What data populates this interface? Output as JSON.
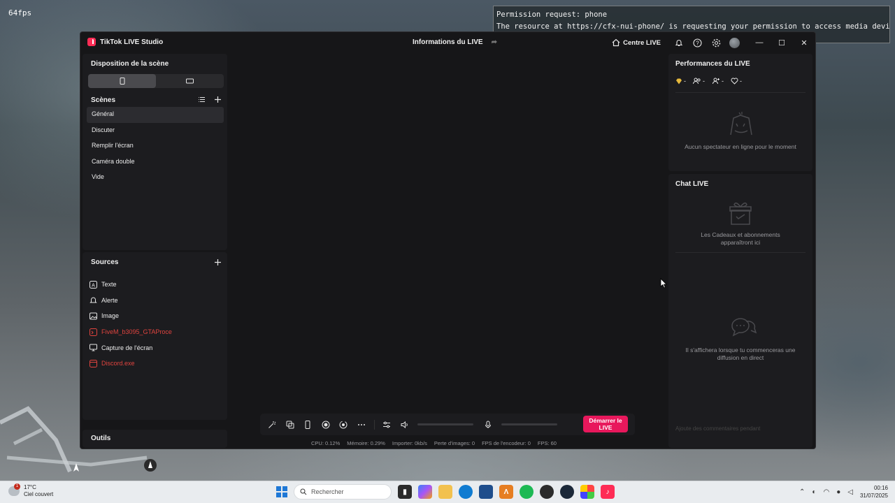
{
  "overlay": {
    "fps": "64fps",
    "permission_title": "Permission request: phone",
    "permission_body": "The resource at https://cfx-nui-phone/ is requesting your permission to access media devices."
  },
  "window": {
    "app_name": "TikTok LIVE Studio",
    "center_title": "Informations du LIVE",
    "centre_live_label": "Centre LIVE"
  },
  "scene_panel": {
    "title": "Disposition de la scène",
    "scenes_header": "Scènes",
    "scenes": [
      "Général",
      "Discuter",
      "Remplir l'écran",
      "Caméra double",
      "Vide"
    ],
    "selected_scene": "Général"
  },
  "sources_panel": {
    "title": "Sources",
    "items": [
      {
        "label": "Texte",
        "icon": "text-icon",
        "error": false
      },
      {
        "label": "Alerte",
        "icon": "bell-icon",
        "error": false
      },
      {
        "label": "Image",
        "icon": "image-icon",
        "error": false
      },
      {
        "label": "FiveM_b3095_GTAProce",
        "icon": "game-capture-icon",
        "error": true
      },
      {
        "label": "Capture de l'écran",
        "icon": "monitor-icon",
        "error": false
      },
      {
        "label": "Discord.exe",
        "icon": "window-capture-icon",
        "error": true
      }
    ]
  },
  "tools": {
    "title": "Outils"
  },
  "controls": {
    "start_live": "Démarrer le LIVE"
  },
  "status": {
    "cpu": "CPU: 0.12%",
    "memory": "Mémoire: 0.29%",
    "import": "Importer: 0kb/s",
    "frame_loss": "Perte d'images: 0",
    "encoder_fps": "FPS de l'encodeur: 0",
    "fps": "FPS: 60"
  },
  "performance": {
    "title": "Performances du LIVE",
    "stats": [
      "-",
      "-",
      "-",
      "-"
    ],
    "empty": "Aucun spectateur en ligne pour le moment"
  },
  "chat": {
    "title": "Chat LIVE",
    "gifts_empty": "Les Cadeaux et abonnements apparaîtront ici",
    "chat_empty": "Il s'affichera lorsque tu commenceras une diffusion en direct",
    "input_placeholder": "Ajoute des commentaires pendant"
  },
  "taskbar": {
    "weather_temp": "17°C",
    "weather_desc": "Ciel couvert",
    "notification_count": "1",
    "search_placeholder": "Rechercher",
    "time": "00:16",
    "date": "31/07/2025"
  },
  "colors": {
    "accent": "#e8185c",
    "error": "#e0443f",
    "panel": "#1c1c1f",
    "window": "#161618"
  }
}
